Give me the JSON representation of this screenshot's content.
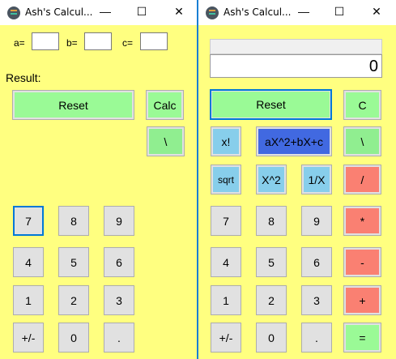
{
  "left": {
    "title": "Ash's Calcul...",
    "a_label": "a=",
    "b_label": "b=",
    "c_label": "c=",
    "a_value": "",
    "b_value": "",
    "c_value": "",
    "result_label": "Result:",
    "reset": "Reset",
    "calc": "Calc",
    "backslash": "\\",
    "digits": [
      "7",
      "8",
      "9",
      "4",
      "5",
      "6",
      "1",
      "2",
      "3",
      "+/-",
      "0",
      "."
    ]
  },
  "right": {
    "title": "Ash's Calcul...",
    "history": "",
    "display": "0",
    "reset": "Reset",
    "clear": "C",
    "factorial": "x!",
    "quadratic": "aX^2+bX+c",
    "backslash": "\\",
    "sqrt": "sqrt",
    "square": "X^2",
    "reciprocal": "1/X",
    "divide": "/",
    "multiply": "*",
    "minus": "-",
    "plus": "+",
    "equals": "=",
    "digits": [
      "7",
      "8",
      "9",
      "4",
      "5",
      "6",
      "1",
      "2",
      "3",
      "+/-",
      "0",
      "."
    ]
  },
  "window_controls": {
    "minimize": "—",
    "maximize": "☐",
    "close": "✕"
  },
  "colors": {
    "background": "#ffff80",
    "green": "#9afa96",
    "sky": "#87ceeb",
    "salmon": "#fa8072",
    "royal": "#4169e1"
  }
}
